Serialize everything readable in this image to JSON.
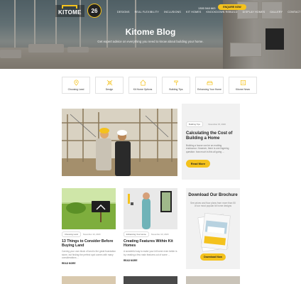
{
  "nav": {
    "logo_text": "KITOME",
    "badge_text": "26",
    "menu_items": [
      "DESIGNS",
      "REAL FLEXIBILITY",
      "INCLUSIONS",
      "KIT HOMES",
      "KNOCKDOWN REBUILD",
      "DISPLAY HOMES",
      "GALLERY",
      "CONTACT"
    ],
    "phone": "1300 548 663",
    "cta": "ENQUIRE NOW"
  },
  "hero": {
    "title": "Kitome Blog",
    "subtitle": "Get expert advice on everything you need to know about building your home."
  },
  "categories": [
    {
      "label": "Choosing Land",
      "icon": "map-pin-icon"
    },
    {
      "label": "Design",
      "icon": "design-tools-icon"
    },
    {
      "label": "Kit Home Options",
      "icon": "house-icon"
    },
    {
      "label": "Building Tips",
      "icon": "hammer-icon"
    },
    {
      "label": "Enhancing Your Home",
      "icon": "sofa-icon"
    },
    {
      "label": "Kitome News",
      "icon": "newspaper-icon"
    }
  ],
  "featured": {
    "tag": "Building Tips",
    "date": "November 15, 2020",
    "title": "Calculating the Cost of Building a Home",
    "excerpt": "Building a house can be an exciting endeavour. However, there is one lingering question: how much is this all going ...",
    "button": "Read More"
  },
  "posts": [
    {
      "tag": "Choosing Land",
      "date": "November 10, 2020",
      "title": "13 Things to Consider Before Buying Land",
      "excerpt": "Carving your own block of land is the great foundation stone, but finding the perfect spot comes with many considerations ...",
      "more": "READ MORE"
    },
    {
      "tag": "Enhancing Your Home",
      "date": "November 10, 2020",
      "title": "Creating Features Within Kit Homes",
      "excerpt": "A wonderful way to make your kit home even better is by creating a few main features out of some ...",
      "more": "READ MORE"
    }
  ],
  "brochure": {
    "title": "Download Our Brochure",
    "description": "See prices and floor plans from more than 50 of our most popular kit home designs",
    "button": "Download Now"
  },
  "colors": {
    "accent": "#f4c21d",
    "card_bg": "#f1f1f1"
  }
}
